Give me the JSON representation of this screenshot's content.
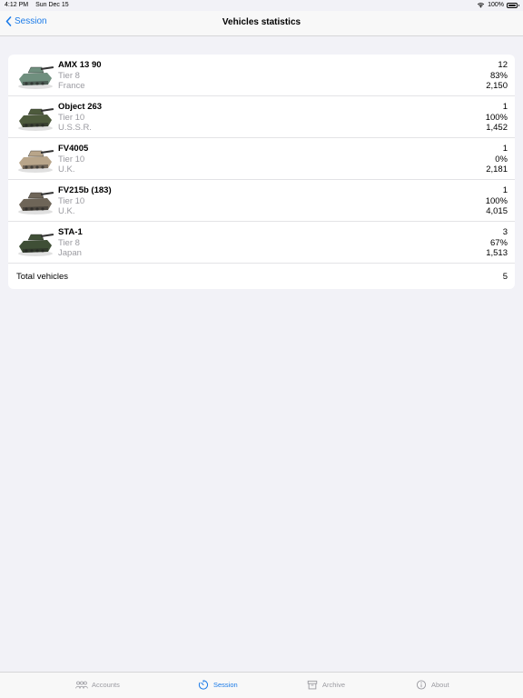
{
  "status_bar": {
    "time": "4:12 PM",
    "date": "Sun Dec 15",
    "battery": "100%"
  },
  "nav": {
    "back_label": "Session",
    "title": "Vehicles statistics"
  },
  "vehicles": [
    {
      "name": "AMX 13 90",
      "tier": "Tier 8",
      "nation": "France",
      "battles": "12",
      "win_rate": "83%",
      "damage": "2,150",
      "color": "#6f8f7e"
    },
    {
      "name": "Object 263",
      "tier": "Tier 10",
      "nation": "U.S.S.R.",
      "battles": "1",
      "win_rate": "100%",
      "damage": "1,452",
      "color": "#4d5a3c"
    },
    {
      "name": "FV4005",
      "tier": "Tier 10",
      "nation": "U.K.",
      "battles": "1",
      "win_rate": "0%",
      "damage": "2,181",
      "color": "#b8a58a"
    },
    {
      "name": "FV215b (183)",
      "tier": "Tier 10",
      "nation": "U.K.",
      "battles": "1",
      "win_rate": "100%",
      "damage": "4,015",
      "color": "#6e6558"
    },
    {
      "name": "STA-1",
      "tier": "Tier 8",
      "nation": "Japan",
      "battles": "3",
      "win_rate": "67%",
      "damage": "1,513",
      "color": "#3f4f36"
    }
  ],
  "total": {
    "label": "Total vehicles",
    "value": "5"
  },
  "tabs": [
    {
      "label": "Accounts",
      "icon": "people-icon",
      "active": false
    },
    {
      "label": "Session",
      "icon": "timer-icon",
      "active": true
    },
    {
      "label": "Archive",
      "icon": "archive-icon",
      "active": false
    },
    {
      "label": "About",
      "icon": "info-icon",
      "active": false
    }
  ],
  "colors": {
    "accent": "#1b7be8",
    "secondary_text": "#9a9aa0",
    "background": "#f2f2f7"
  }
}
